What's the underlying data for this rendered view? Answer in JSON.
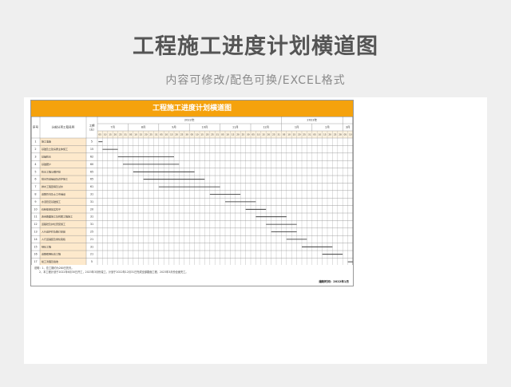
{
  "page": {
    "title": "工程施工进度计划横道图",
    "subtitle": "内容可修改/配色可换/EXCEL格式"
  },
  "doc": {
    "title": "工程施工进度计划横道图",
    "headers": {
      "no": "序号",
      "item": "分部分项工程名称",
      "duration": "工期（天）"
    },
    "years": [
      {
        "label": "2022年",
        "months": 6
      },
      {
        "label": "2023年",
        "months": 2
      }
    ],
    "months": [
      {
        "label": "7月",
        "days": [
          "05",
          "10",
          "15",
          "20",
          "25",
          "31"
        ]
      },
      {
        "label": "8月",
        "days": [
          "05",
          "10",
          "15",
          "20",
          "25",
          "31"
        ]
      },
      {
        "label": "9月",
        "days": [
          "05",
          "10",
          "15",
          "20",
          "25",
          "30"
        ]
      },
      {
        "label": "10月",
        "days": [
          "05",
          "10",
          "15",
          "20",
          "25",
          "31"
        ]
      },
      {
        "label": "11月",
        "days": [
          "05",
          "10",
          "15",
          "20",
          "25",
          "30"
        ]
      },
      {
        "label": "12月",
        "days": [
          "05",
          "10",
          "15",
          "20",
          "25",
          "31"
        ]
      },
      {
        "label": "1月",
        "days": [
          "05",
          "10",
          "15",
          "20",
          "25",
          "31"
        ]
      },
      {
        "label": "2月",
        "days": [
          "05",
          "10",
          "15",
          "20",
          "25",
          "28"
        ]
      },
      {
        "label": "3月",
        "days": [
          "05",
          "10"
        ]
      }
    ],
    "tasks": [
      {
        "no": "1",
        "name": "施工准备",
        "days": "5",
        "start": 0.2,
        "end": 1
      },
      {
        "no": "2",
        "name": "基础及土建房屋主体施工",
        "days": "15",
        "start": 1,
        "end": 4
      },
      {
        "no": "3",
        "name": "基础防水",
        "days": "62",
        "start": 4,
        "end": 15
      },
      {
        "no": "4",
        "name": "基础肥户",
        "days": "60",
        "start": 5,
        "end": 16
      },
      {
        "no": "5",
        "name": "防水工程与槽开挖",
        "days": "65",
        "start": 7,
        "end": 19
      },
      {
        "no": "6",
        "name": "排水管道铺设及养护施工",
        "days": "65",
        "start": 9,
        "end": 21
      },
      {
        "no": "7",
        "name": "排水工程回填及试水",
        "days": "61",
        "start": 12,
        "end": 24
      },
      {
        "no": "8",
        "name": "道路管沟及土工布铺设",
        "days": "31",
        "start": 22,
        "end": 28
      },
      {
        "no": "9",
        "name": "水泥稳定基础施工",
        "days": "31",
        "start": 25,
        "end": 31
      },
      {
        "no": "10",
        "name": "石粉垫层压实找平",
        "days": "20",
        "start": 29,
        "end": 33
      },
      {
        "no": "11",
        "name": "沥青路面施工及附属工程施工",
        "days": "31",
        "start": 31,
        "end": 37
      },
      {
        "no": "12",
        "name": "道路砼及护栏安装施工",
        "days": "31",
        "start": 33,
        "end": 39
      },
      {
        "no": "13",
        "name": "人行道护栏及路灯安装",
        "days": "25",
        "start": 34,
        "end": 39
      },
      {
        "no": "14",
        "name": "人行道铺装及绿化栽植",
        "days": "21",
        "start": 37,
        "end": 41
      },
      {
        "no": "15",
        "name": "绿化工程",
        "days": "31",
        "start": 40,
        "end": 46
      },
      {
        "no": "16",
        "name": "道路照明标志工程",
        "days": "21",
        "start": 44,
        "end": 48
      },
      {
        "no": "17",
        "name": "竣工清理及验收",
        "days": "5",
        "start": 49,
        "end": 50
      }
    ],
    "notes": [
      "说明：1、总工期约为280日历天。",
      "2、本工程计划于2022年6月30日开工，2023年3月份竣工，计划于2022年12月31日完成全部路面工程，2023年3月份全面完工。"
    ],
    "sign": "编制时间：2022年1月",
    "colors": {
      "accent": "#f5a20d",
      "nameCell": "#fde9cc",
      "dayCell": "#fdf3e0"
    }
  }
}
